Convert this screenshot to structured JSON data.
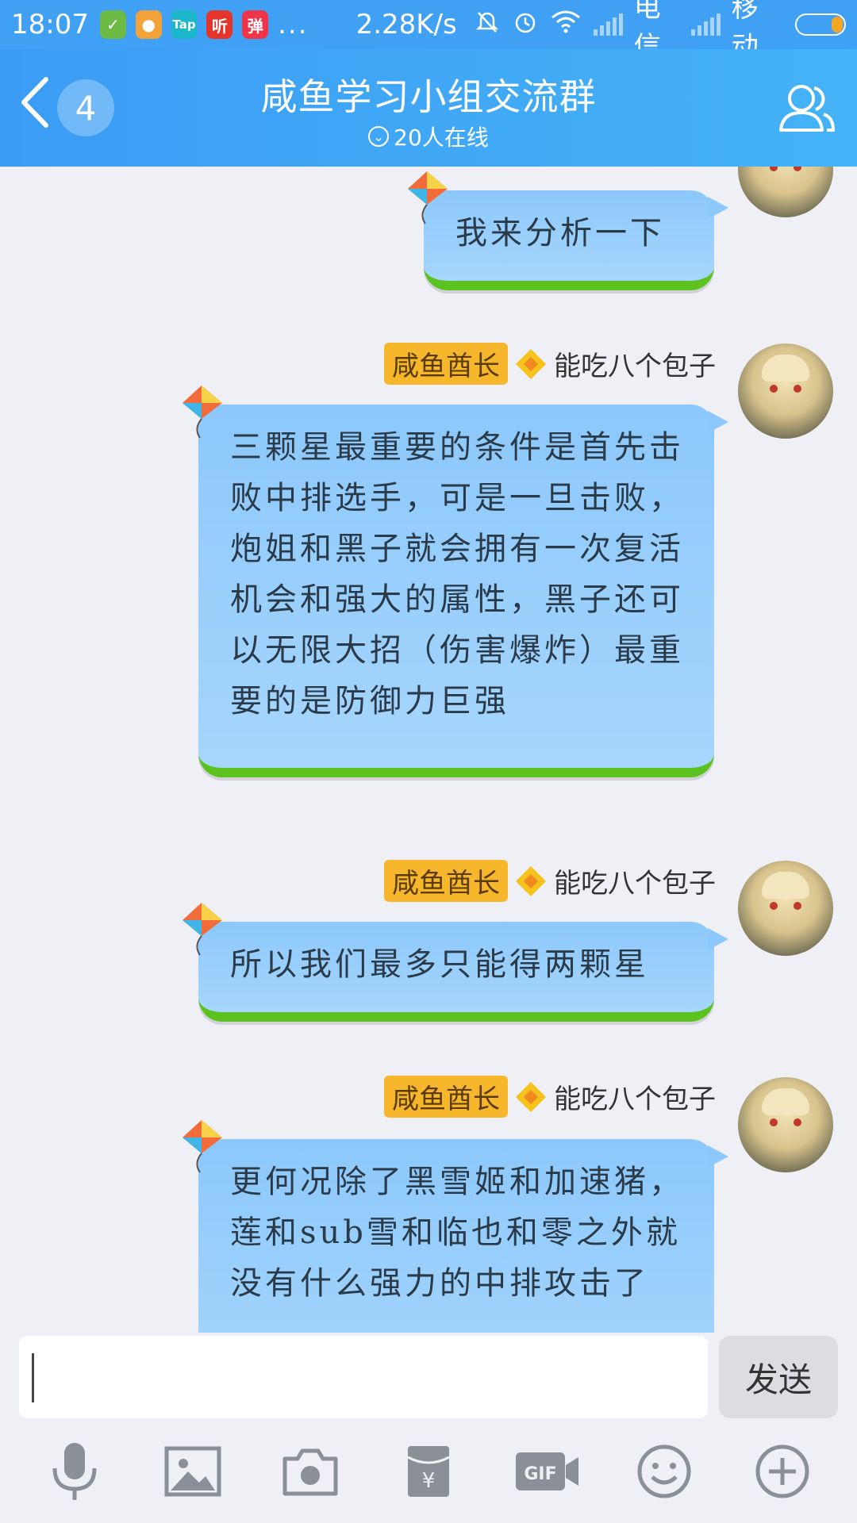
{
  "status_bar": {
    "time": "18:07",
    "apps": [
      {
        "name": "shield-app-icon",
        "glyph": "✓",
        "color": "#6dbb45"
      },
      {
        "name": "chat-app-icon",
        "glyph": "●",
        "color": "#f3a23a"
      },
      {
        "name": "taptap-app-icon",
        "glyph": "Tap",
        "color": "#19b7c8"
      },
      {
        "name": "listen-app-icon",
        "glyph": "听",
        "color": "#e5352b"
      },
      {
        "name": "danmaku-app-icon",
        "glyph": "弹",
        "color": "#f0354b"
      }
    ],
    "more": "...",
    "network_speed": "2.28K/s",
    "carrier1": "电信",
    "carrier2": "移动"
  },
  "header": {
    "unread_count": "4",
    "title": "咸鱼学习小组交流群",
    "online_text": "20人在线"
  },
  "messages": [
    {
      "text": "我来分析一下",
      "show_sender": false
    },
    {
      "rank": "咸鱼酋长",
      "sender": "能吃八个包子",
      "text": "三颗星最重要的条件是首先击败中排选手，可是一旦击败，炮姐和黑子就会拥有一次复活机会和强大的属性，黑子还可以无限大招（伤害爆炸）最重要的是防御力巨强"
    },
    {
      "rank": "咸鱼酋长",
      "sender": "能吃八个包子",
      "text": "所以我们最多只能得两颗星"
    },
    {
      "rank": "咸鱼酋长",
      "sender": "能吃八个包子",
      "text": "更何况除了黑雪姬和加速猪，莲和sub雪和临也和零之外就没有什么强力的中排攻击了"
    }
  ],
  "composer": {
    "input_value": "",
    "send_label": "发送"
  },
  "colors": {
    "header_bg": "#3b9cf5",
    "bubble": "#9dd0fc",
    "bubble_grass": "#5cc21f",
    "rank_badge": "#f6b72d"
  }
}
